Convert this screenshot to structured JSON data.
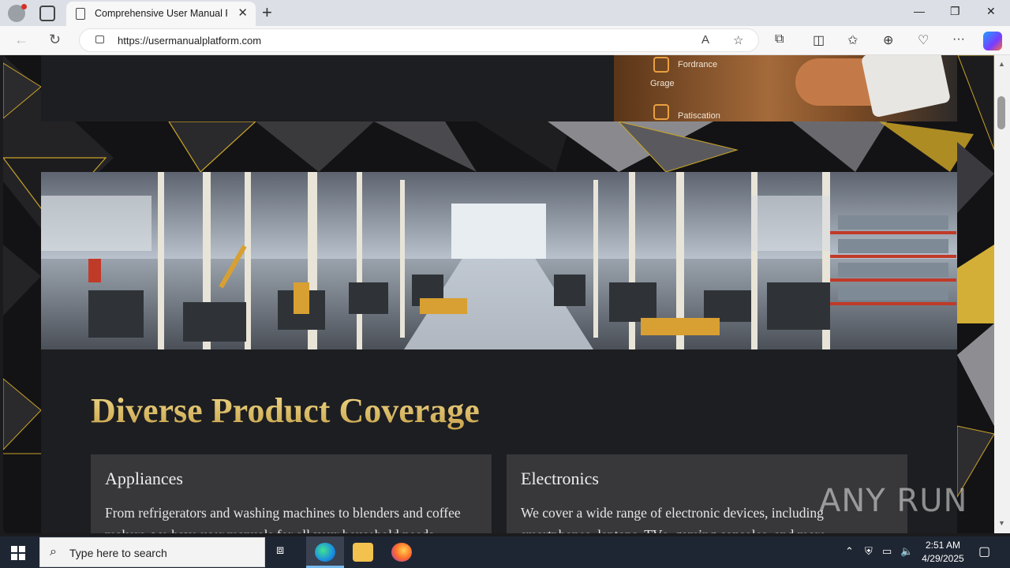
{
  "browser": {
    "tab_title": "Comprehensive User Manual Platform",
    "url": "https://usermanualplatform.com",
    "new_tab_label": "+",
    "close_tab_label": "✕"
  },
  "window_controls": {
    "minimize": "—",
    "restore": "❐",
    "close": "✕"
  },
  "promo_panel": {
    "items": [
      "Fordrance",
      "Grage",
      "Patiscation"
    ]
  },
  "page": {
    "section_heading": "Diverse Product Coverage",
    "cards": [
      {
        "title": "Appliances",
        "text": "From refrigerators and washing machines to blenders and coffee makers, we have user manuals for all your household needs."
      },
      {
        "title": "Electronics",
        "text": "We cover a wide range of electronic devices, including smartphones, laptops, TVs, gaming consoles, and more."
      }
    ]
  },
  "watermark": "ANY RUN",
  "taskbar": {
    "search_placeholder": "Type here to search",
    "time": "2:51 AM",
    "date": "4/29/2025"
  },
  "colors": {
    "accent_gold": "#e1bf6a",
    "page_bg": "#121214",
    "card_bg": "#38383b"
  },
  "icons": [
    "profile-icon",
    "tabs-icon",
    "back-icon",
    "refresh-icon",
    "lock-icon",
    "read-aloud-icon",
    "favorite-star-icon",
    "extensions-icon",
    "split-screen-icon",
    "favorites-icon",
    "collections-icon",
    "performance-icon",
    "more-icon",
    "copilot-icon",
    "windows-start-icon",
    "search-icon",
    "task-view-icon",
    "edge-icon",
    "file-explorer-icon",
    "firefox-icon"
  ]
}
